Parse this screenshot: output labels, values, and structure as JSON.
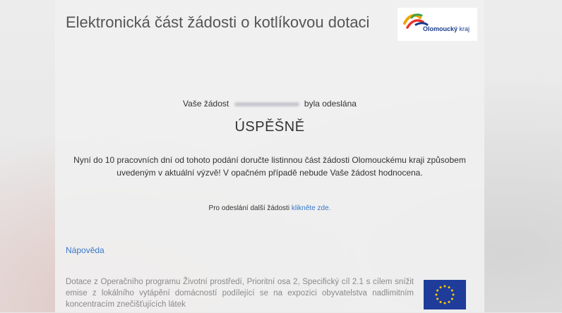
{
  "header": {
    "title": "Elektronická část žádosti o kotlíkovou dotaci",
    "logo_name": "Olomoucký",
    "logo_suffix": "kraj"
  },
  "result": {
    "sent_prefix": "Vaše žádost",
    "sent_suffix": "byla odeslána",
    "status": "ÚSPĚŠNĚ",
    "message": "Nyní do 10 pracovních dní od tohoto podání doručte listinnou část žádosti Olomouckému kraji způsobem uvedeným v aktuální výzvě! V opačném případě nebude Vaše žádost hodnocena.",
    "another_prefix": "Pro odeslání další žádosti",
    "another_link": "klikněte zde."
  },
  "help": {
    "link_label": "Nápověda",
    "info_text": "Dotace z Operačního programu Životní prostředí, Prioritní osa 2, Specifický cíl 2.1 s cílem snížit emise z lokálního vytápění domácností podílející se na expozici obyvatelstva nadlimitním koncentracím znečišťujících látek"
  },
  "colors": {
    "link": "#3a78c9",
    "eu_blue": "#1f3c9b",
    "eu_star": "#ffcc00"
  }
}
